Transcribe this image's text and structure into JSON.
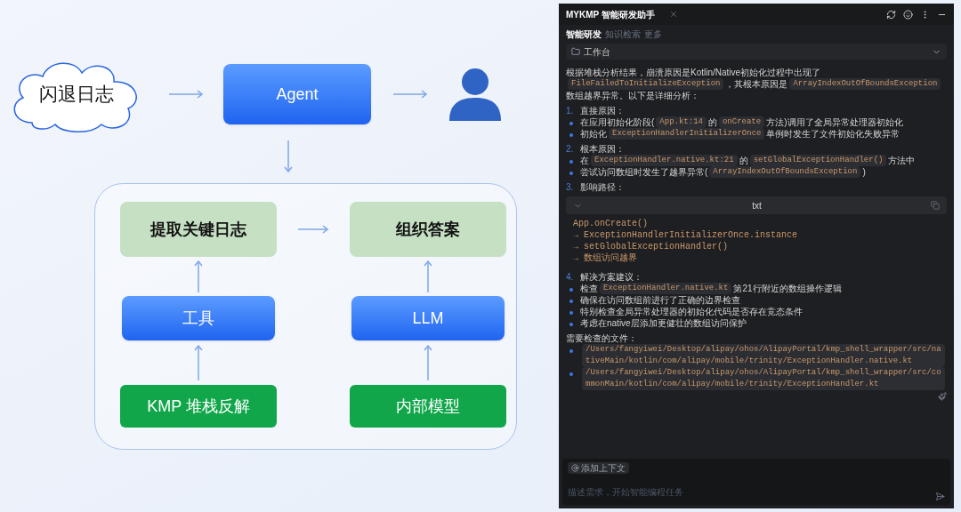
{
  "diagram": {
    "input": "闪退日志",
    "agent": "Agent",
    "columns": [
      {
        "result": "提取关键日志",
        "processor": "工具",
        "source": "KMP 堆栈反解"
      },
      {
        "result": "组织答案",
        "processor": "LLM",
        "source": "内部模型"
      }
    ]
  },
  "panel": {
    "title": "MYKMP 智能研发助手",
    "tabs": [
      {
        "label": "智能研发",
        "selected": true
      },
      {
        "label": "知识检索",
        "selected": false
      },
      {
        "label": "更多",
        "selected": false
      }
    ],
    "workspace": "工作台",
    "blocks": [
      {
        "kind": "paragraph",
        "segments": [
          {
            "kind": "text",
            "text": "根据堆栈分析结果，崩溃原因是Kotlin/Native初始化过程中出现了"
          },
          {
            "kind": "code",
            "text": "FileFailedToInitializeException"
          },
          {
            "kind": "text",
            "text": "，其根本原因是"
          },
          {
            "kind": "code",
            "text": "ArrayIndexOutOfBoundsException"
          },
          {
            "kind": "text",
            "text": "数组越界异常。以下是详细分析："
          }
        ]
      },
      {
        "kind": "numbered",
        "number": "1.",
        "segments": [
          {
            "kind": "text",
            "text": "直接原因："
          }
        ]
      },
      {
        "kind": "bullet",
        "segments": [
          {
            "kind": "text",
            "text": "在应用初始化阶段("
          },
          {
            "kind": "code",
            "text": "App.kt:14"
          },
          {
            "kind": "text",
            "text": "的"
          },
          {
            "kind": "code",
            "text": "onCreate"
          },
          {
            "kind": "text",
            "text": "方法)调用了全局异常处理器初始化"
          }
        ]
      },
      {
        "kind": "bullet",
        "segments": [
          {
            "kind": "text",
            "text": "初始化"
          },
          {
            "kind": "code",
            "text": "ExceptionHandlerInitializerOnce"
          },
          {
            "kind": "text",
            "text": "单例时发生了文件初始化失败异常"
          }
        ]
      },
      {
        "kind": "numbered",
        "number": "2.",
        "segments": [
          {
            "kind": "text",
            "text": "根本原因："
          }
        ]
      },
      {
        "kind": "bullet",
        "segments": [
          {
            "kind": "text",
            "text": "在"
          },
          {
            "kind": "code",
            "text": "ExceptionHandler.native.kt:21"
          },
          {
            "kind": "text",
            "text": "的"
          },
          {
            "kind": "code",
            "text": "setGlobalExceptionHandler()"
          },
          {
            "kind": "text",
            "text": "方法中"
          }
        ]
      },
      {
        "kind": "bullet",
        "segments": [
          {
            "kind": "text",
            "text": "尝试访问数组时发生了越界异常("
          },
          {
            "kind": "code",
            "text": "ArrayIndexOutOfBoundsException"
          },
          {
            "kind": "text",
            "text": ")"
          }
        ]
      },
      {
        "kind": "numbered",
        "number": "3.",
        "segments": [
          {
            "kind": "text",
            "text": "影响路径："
          }
        ]
      },
      {
        "kind": "code_block",
        "language": "txt",
        "lines": [
          "App.onCreate()",
          "→ ExceptionHandlerInitializerOnce.instance",
          "→ setGlobalExceptionHandler()",
          "→ 数组访问越界"
        ]
      },
      {
        "kind": "numbered",
        "number": "4.",
        "segments": [
          {
            "kind": "text",
            "text": "解决方案建议："
          }
        ]
      },
      {
        "kind": "bullet",
        "segments": [
          {
            "kind": "text",
            "text": "检查"
          },
          {
            "kind": "code",
            "text": "ExceptionHandler.native.kt"
          },
          {
            "kind": "text",
            "text": "第21行附近的数组操作逻辑"
          }
        ]
      },
      {
        "kind": "bullet",
        "segments": [
          {
            "kind": "text",
            "text": "确保在访问数组前进行了正确的边界检查"
          }
        ]
      },
      {
        "kind": "bullet",
        "segments": [
          {
            "kind": "text",
            "text": "特别检查全局异常处理器的初始化代码是否存在竞态条件"
          }
        ]
      },
      {
        "kind": "bullet",
        "segments": [
          {
            "kind": "text",
            "text": "考虑在native层添加更健壮的数组访问保护"
          }
        ]
      },
      {
        "kind": "paragraph",
        "segments": [
          {
            "kind": "text",
            "text": "需要检查的文件："
          }
        ]
      },
      {
        "kind": "bullet",
        "segments": [
          {
            "kind": "code",
            "text": "/Users/fangyiwei/Desktop/alipay/ohos/AlipayPortal/kmp_shell_wrapper/src/nativeMain/kotlin/com/alipay/mobile/trinity/ExceptionHandler.native.kt"
          }
        ]
      },
      {
        "kind": "bullet",
        "segments": [
          {
            "kind": "code",
            "text": "/Users/fangyiwei/Desktop/alipay/ohos/AlipayPortal/kmp_shell_wrapper/src/commonMain/kotlin/com/alipay/mobile/trinity/ExceptionHandler.kt"
          }
        ]
      }
    ],
    "context_chip": "添加上下文",
    "input": {
      "placeholder": "描述需求，开始智能编程任务"
    }
  }
}
